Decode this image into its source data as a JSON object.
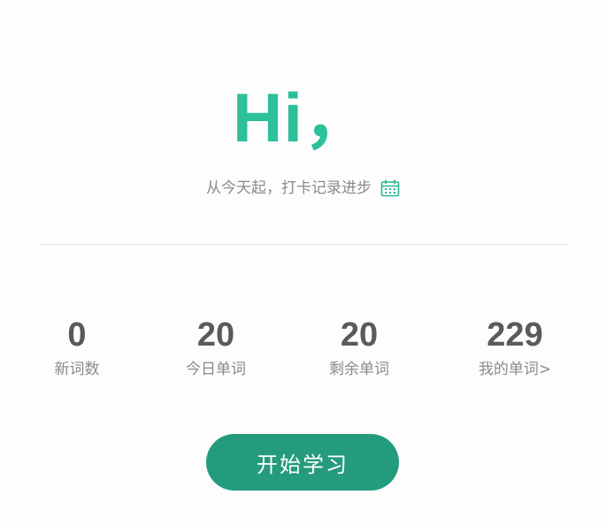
{
  "colors": {
    "accent": "#2cc09b",
    "button": "#259b7e",
    "icon": "#2cb592"
  },
  "header": {
    "greeting": "Hi，",
    "subtitle": "从今天起，打卡记录进步",
    "calendar_icon": "calendar-icon"
  },
  "stats": [
    {
      "value": "0",
      "label": "新词数"
    },
    {
      "value": "20",
      "label": "今日单词"
    },
    {
      "value": "20",
      "label": "剩余单词"
    },
    {
      "value": "229",
      "label": "我的单词>"
    }
  ],
  "actions": {
    "start_label": "开始学习"
  }
}
